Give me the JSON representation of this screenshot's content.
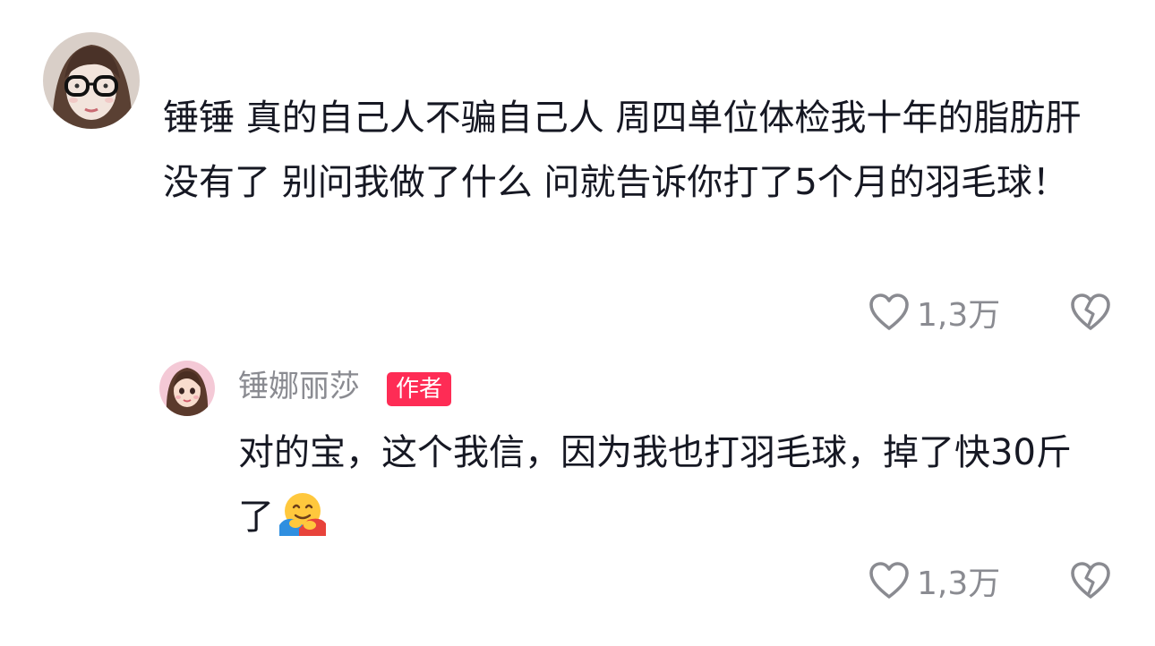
{
  "main_comment": {
    "avatar_icon": "avatar-girl-glasses-icon",
    "text": "锤锤 真的自己人不骗自己人 周四单位体检我十年的脂肪肝没有了 别问我做了什么 问就告诉你打了5个月的羽毛球！",
    "like_count": "1,3万",
    "like_icon": "heart-outline-icon",
    "dislike_icon": "broken-heart-icon"
  },
  "reply": {
    "avatar_icon": "avatar-cartoon-girl-icon",
    "username": "锤娜丽莎",
    "badge": "作者",
    "text": "对的宝，这个我信，因为我也打羽毛球，掉了快30斤了",
    "emoji_icon": "hugging-face-emoji",
    "like_count": "1,3万",
    "like_icon": "heart-outline-icon",
    "dislike_icon": "broken-heart-icon"
  },
  "colors": {
    "text": "#161823",
    "muted": "#8a8b91",
    "badge": "#fe2c55"
  }
}
